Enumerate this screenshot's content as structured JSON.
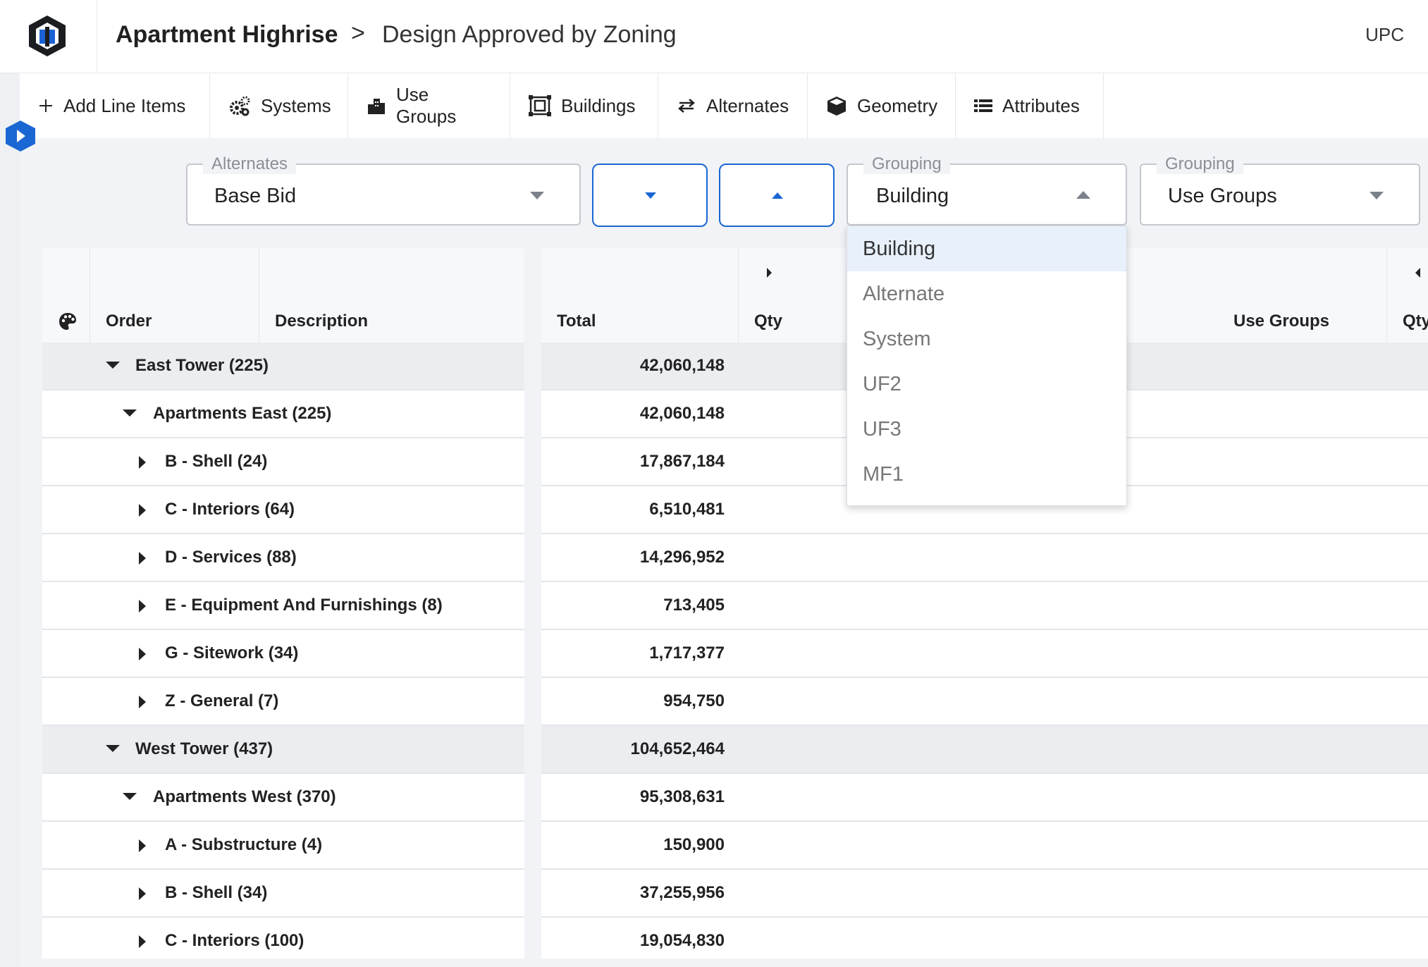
{
  "header": {
    "project": "Apartment Highrise",
    "separator": ">",
    "estimate": "Design Approved by Zoning",
    "user": "UPC"
  },
  "toolbar": {
    "items": [
      {
        "label": "Add Line Items",
        "icon": "plus-icon"
      },
      {
        "label": "Systems",
        "icon": "gears-icon"
      },
      {
        "label": "Use Groups",
        "icon": "city-icon"
      },
      {
        "label": "Buildings",
        "icon": "building-frame-icon"
      },
      {
        "label": "Alternates",
        "icon": "swap-arrows-icon"
      },
      {
        "label": "Geometry",
        "icon": "cube-icon"
      },
      {
        "label": "Attributes",
        "icon": "list-icon"
      }
    ]
  },
  "filters": {
    "alternates": {
      "legend": "Alternates",
      "value": "Base Bid"
    },
    "grouping1": {
      "legend": "Grouping",
      "value": "Building"
    },
    "grouping2": {
      "legend": "Grouping",
      "value": "Use Groups"
    }
  },
  "dropdown": {
    "options": [
      "Building",
      "Alternate",
      "System",
      "UF2",
      "UF3",
      "MF1"
    ],
    "selected": "Building"
  },
  "grid": {
    "left_columns": {
      "order": "Order",
      "description": "Description"
    },
    "right_columns": {
      "total": "Total",
      "qty": "Qty",
      "use_groups": "Use Groups",
      "qty2": "Qty"
    },
    "rows": [
      {
        "name": "East Tower (225)",
        "total": "42,060,148"
      },
      {
        "name": "Apartments East (225)",
        "total": "42,060,148"
      },
      {
        "name": "B - Shell (24)",
        "total": "17,867,184"
      },
      {
        "name": "C - Interiors (64)",
        "total": "6,510,481"
      },
      {
        "name": "D - Services (88)",
        "total": "14,296,952"
      },
      {
        "name": "E - Equipment And Furnishings (8)",
        "total": "713,405"
      },
      {
        "name": "G - Sitework (34)",
        "total": "1,717,377"
      },
      {
        "name": "Z - General (7)",
        "total": "954,750"
      },
      {
        "name": "West Tower (437)",
        "total": "104,652,464"
      },
      {
        "name": "Apartments West (370)",
        "total": "95,308,631"
      },
      {
        "name": "A - Substructure (4)",
        "total": "150,900"
      },
      {
        "name": "B - Shell (34)",
        "total": "37,255,956"
      },
      {
        "name": "C - Interiors (100)",
        "total": "19,054,830"
      }
    ]
  },
  "colors": {
    "accent": "#1a66d2",
    "group_row": "#ebedf0",
    "selected_option": "#e7f0fb"
  }
}
